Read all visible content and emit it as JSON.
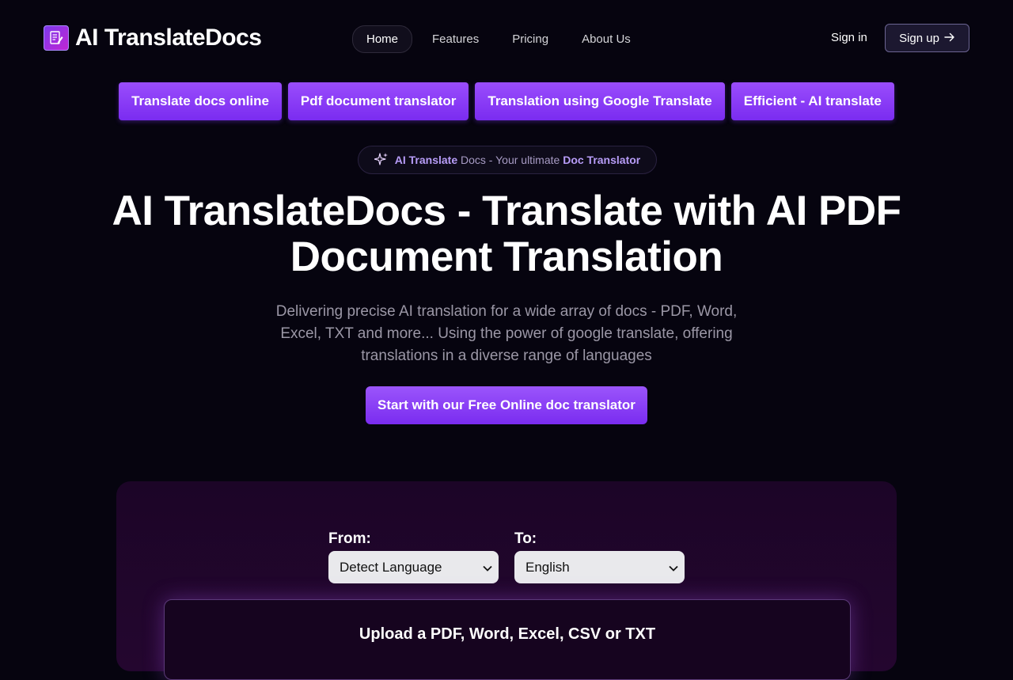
{
  "header": {
    "brand": "AI TranslateDocs",
    "nav": [
      {
        "label": "Home",
        "active": true
      },
      {
        "label": "Features",
        "active": false
      },
      {
        "label": "Pricing",
        "active": false
      },
      {
        "label": "About Us",
        "active": false
      }
    ],
    "signin": "Sign in",
    "signup": "Sign up"
  },
  "pills": [
    "Translate docs online",
    "Pdf document translator",
    "Translation using Google Translate",
    "Efficient - AI translate"
  ],
  "tagline": {
    "part1": "AI Translate",
    "part2": "Docs - Your ultimate",
    "part3": "Doc Translator"
  },
  "hero": {
    "title": "AI TranslateDocs - Translate with AI  PDF Document Translation",
    "subtitle": "Delivering precise AI translation for a wide array of docs - PDF, Word, Excel, TXT and more... Using the power of google translate, offering translations in a diverse range of languages",
    "cta": "Start with our Free Online doc translator"
  },
  "translator": {
    "from_label": "From:",
    "from_value": "Detect Language",
    "to_label": "To:",
    "to_value": "English",
    "upload_text": "Upload a PDF, Word, Excel, CSV or TXT"
  },
  "colors": {
    "background": "#06040f",
    "accent": "#8b3cf7",
    "card": "#1c0527"
  }
}
